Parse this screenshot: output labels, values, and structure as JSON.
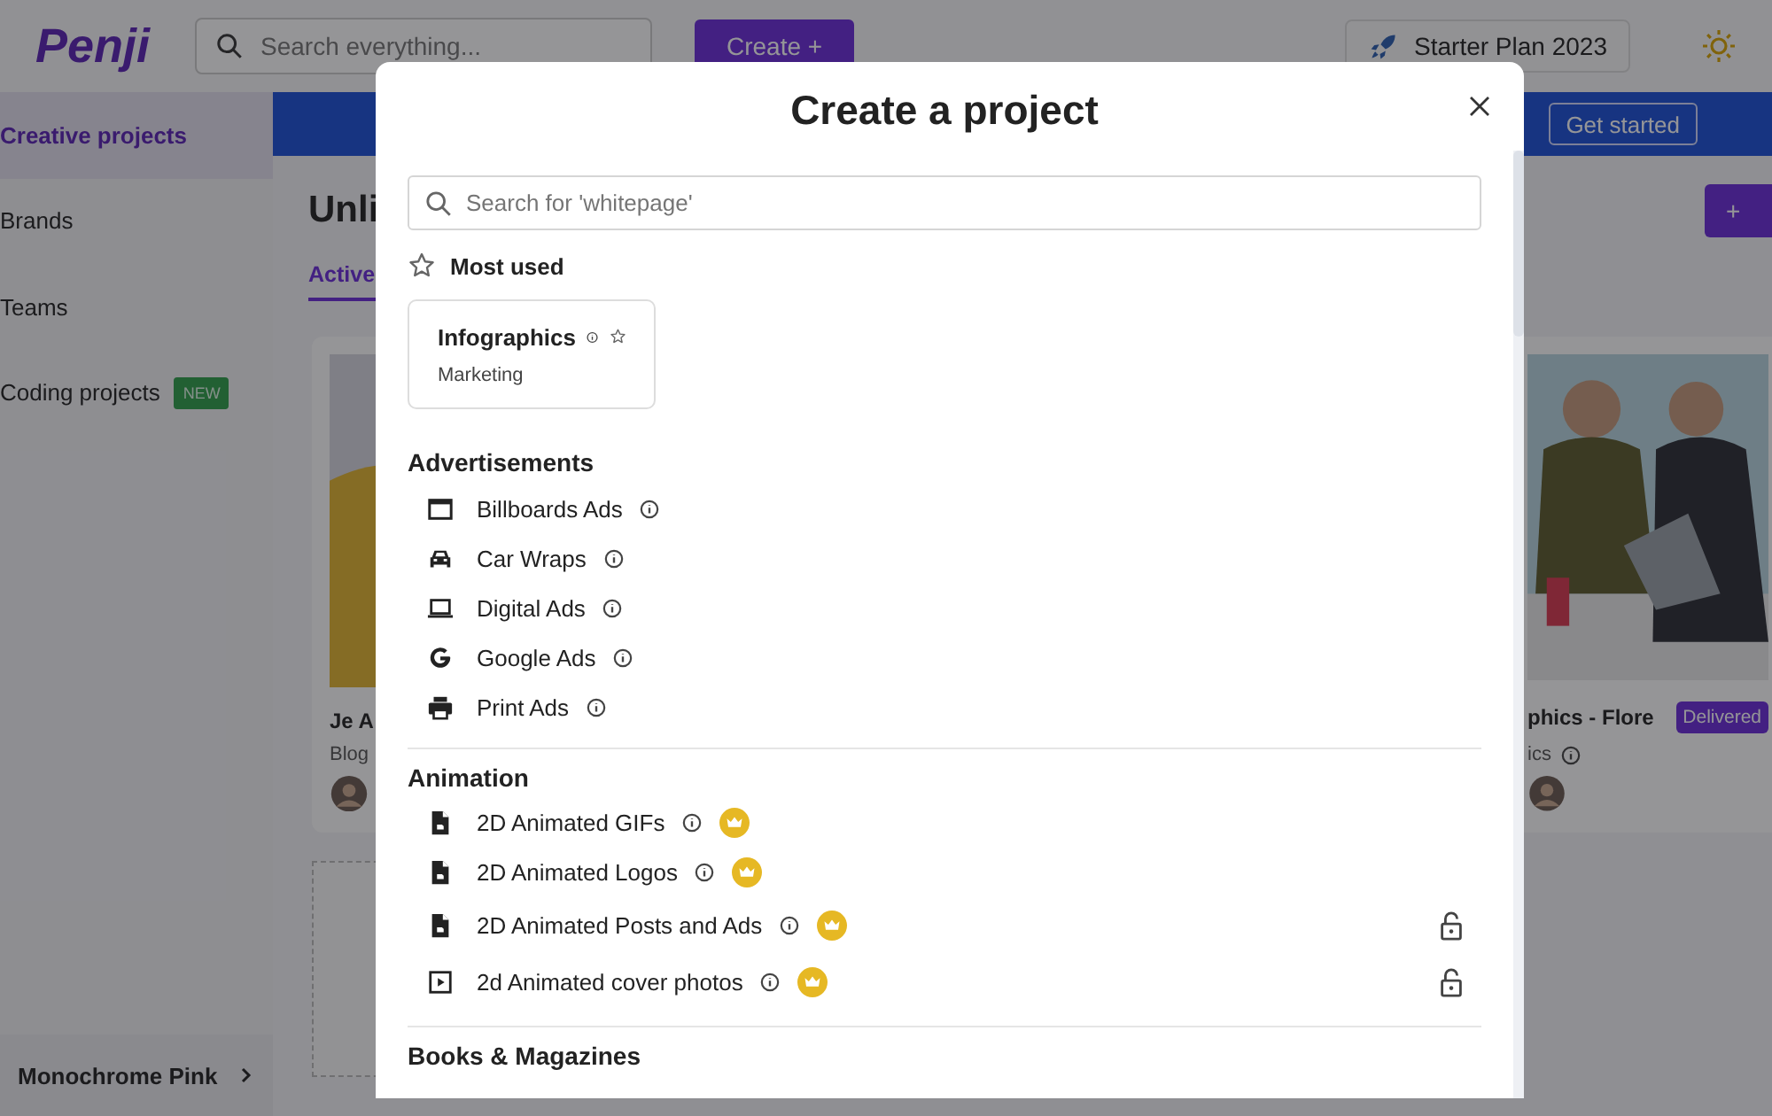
{
  "header": {
    "logo": "Penji",
    "search": {
      "placeholder": "Search everything..."
    },
    "create_button": "Create",
    "create_icon": "+",
    "plan_button": "Starter Plan 2023"
  },
  "sidebar": {
    "items": [
      {
        "label": "Creative projects",
        "selected": true
      },
      {
        "label": "Brands",
        "selected": false
      },
      {
        "label": "Teams",
        "selected": false
      },
      {
        "label": "Coding projects",
        "selected": false,
        "badge": "NEW"
      }
    ],
    "footer": "Monochrome Pink"
  },
  "banner": {
    "button": "Get started"
  },
  "main": {
    "title": "Unli",
    "new_button": "+",
    "tabs": [
      {
        "label": "Active",
        "selected": true
      }
    ],
    "cards": [
      {
        "title": "Je A",
        "subtitle": "Blog"
      },
      {
        "title": "phics - Flore",
        "subtitle": "ics",
        "status": "Delivered"
      }
    ]
  },
  "modal": {
    "title": "Create a project",
    "search": {
      "placeholder": "Search for 'whitepage'"
    },
    "most_used": {
      "label": "Most used",
      "items": [
        {
          "title": "Infographics",
          "category": "Marketing"
        }
      ]
    },
    "sections": [
      {
        "title": "Advertisements",
        "items": [
          {
            "label": "Billboards Ads",
            "kind": "billboard",
            "premium": false,
            "locked": false
          },
          {
            "label": "Car Wraps",
            "kind": "car",
            "premium": false,
            "locked": false
          },
          {
            "label": "Digital Ads",
            "kind": "laptop",
            "premium": false,
            "locked": false
          },
          {
            "label": "Google Ads",
            "kind": "google",
            "premium": false,
            "locked": false
          },
          {
            "label": "Print Ads",
            "kind": "printer",
            "premium": false,
            "locked": false
          }
        ]
      },
      {
        "title": "Animation",
        "items": [
          {
            "label": "2D Animated GIFs",
            "kind": "file",
            "premium": true,
            "locked": false
          },
          {
            "label": "2D Animated Logos",
            "kind": "file",
            "premium": true,
            "locked": false
          },
          {
            "label": "2D Animated Posts and Ads",
            "kind": "file",
            "premium": true,
            "locked": true
          },
          {
            "label": "2d Animated cover photos",
            "kind": "video",
            "premium": true,
            "locked": true
          }
        ]
      },
      {
        "title": "Books & Magazines"
      }
    ]
  }
}
